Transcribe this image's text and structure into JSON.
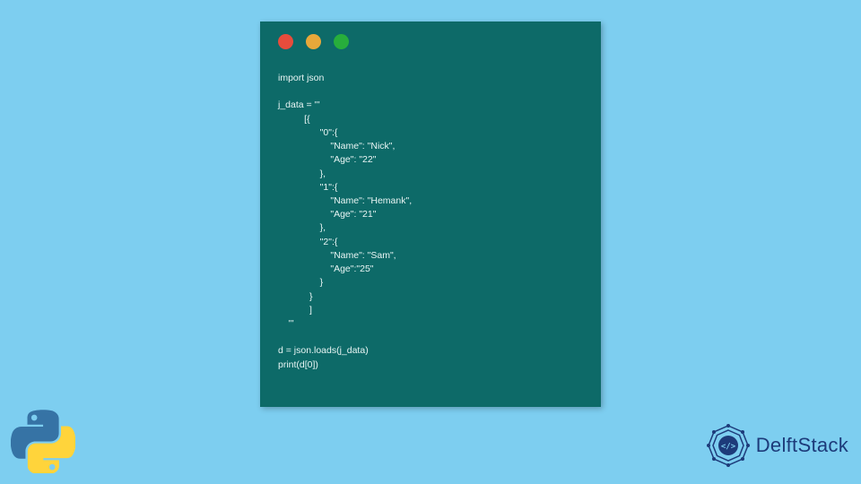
{
  "code_window": {
    "traffic_lights": {
      "red": "red",
      "amber": "amber",
      "green": "green"
    },
    "code": "import json\n\nj_data = '''\n          [{\n                \"0\":{\n                    \"Name\": \"Nick\",\n                    \"Age\": \"22\"\n                },\n                \"1\":{\n                    \"Name\": \"Hemank\",\n                    \"Age\": \"21\"\n                },\n                \"2\":{\n                    \"Name\": \"Sam\",\n                    \"Age\":\"25\"\n                }\n            }\n            ]\n    '''\n\nd = json.loads(j_data)\nprint(d[0])"
  },
  "branding": {
    "python_logo": "python-logo",
    "delftstack_text": "DelftStack",
    "delftstack_icon": "delftstack-icon"
  }
}
